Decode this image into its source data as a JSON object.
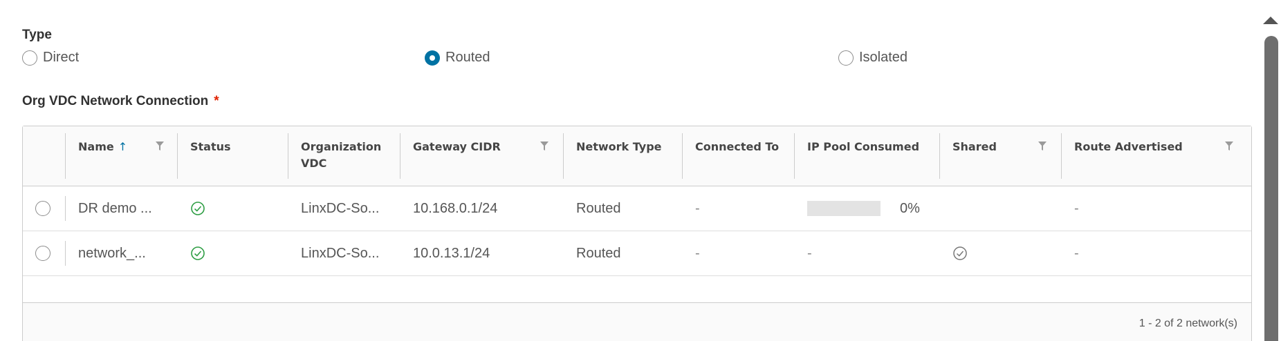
{
  "type_group": {
    "label": "Type",
    "options": [
      {
        "label": "Direct",
        "checked": false
      },
      {
        "label": "Routed",
        "checked": true
      },
      {
        "label": "Isolated",
        "checked": false
      }
    ]
  },
  "connection": {
    "label": "Org VDC Network Connection",
    "required_mark": "*"
  },
  "grid": {
    "columns": [
      {
        "label": "Name",
        "sort": "ascending",
        "filterable": true
      },
      {
        "label": "Status",
        "filterable": false
      },
      {
        "label": "Organization VDC",
        "filterable": false
      },
      {
        "label": "Gateway CIDR",
        "filterable": true
      },
      {
        "label": "Network Type",
        "filterable": false
      },
      {
        "label": "Connected To",
        "filterable": false
      },
      {
        "label": "IP Pool Consumed",
        "filterable": false
      },
      {
        "label": "Shared",
        "filterable": true
      },
      {
        "label": "Route Advertised",
        "filterable": true
      }
    ],
    "rows": [
      {
        "name": "DR demo ...",
        "status": "check-circle-icon",
        "org_vdc": "LinxDC-So...",
        "gateway_cidr": "10.168.0.1/24",
        "network_type": "Routed",
        "connected_to": "-",
        "ip_pool_percent": "0%",
        "ip_pool_fraction": 0,
        "shared": "",
        "route_advertised": "-"
      },
      {
        "name": "network_...",
        "status": "check-circle-icon",
        "org_vdc": "LinxDC-So...",
        "gateway_cidr": "10.0.13.1/24",
        "network_type": "Routed",
        "connected_to": "-",
        "ip_pool_percent": "-",
        "shared": "check-circle-icon",
        "route_advertised": "-"
      }
    ],
    "footer": "1 - 2 of 2 network(s)"
  },
  "colors": {
    "accent": "#0072a3",
    "status_ok": "#2e9e44",
    "required": "#e12200"
  }
}
